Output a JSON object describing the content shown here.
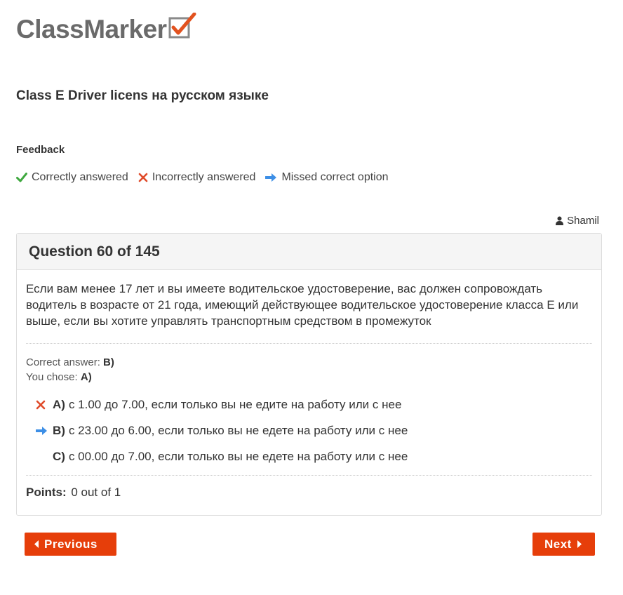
{
  "logo": {
    "text": "ClassMarker"
  },
  "test": {
    "title": "Class E Driver licens на русском языке"
  },
  "feedback": {
    "heading": "Feedback",
    "legend": {
      "correct": "Correctly answered",
      "incorrect": "Incorrectly answered",
      "missed": "Missed correct option"
    }
  },
  "user": {
    "name": "Shamil",
    "icon": "user-icon"
  },
  "question": {
    "header": "Question 60 of 145",
    "text": "Если вам менее 17 лет и вы имеете водительское удостоверение, вас должен сопровождать водитель в возрасте от 21 года, имеющий действующее водительское удостоверение класса Е или выше, если вы хотите управлять транспортным средством в промежуток",
    "correct_label": "Correct answer:",
    "correct_value": "B)",
    "chose_label": "You chose:",
    "chose_value": "A)",
    "options": [
      {
        "letter": "A)",
        "text": "с 1.00 до 7.00, если только вы не едите на работу или с нее",
        "mark": "incorrect"
      },
      {
        "letter": "B)",
        "text": "с 23.00 до 6.00, если только вы не едете на работу или с нее",
        "mark": "missed"
      },
      {
        "letter": "C)",
        "text": "с 00.00 до 7.00, если только вы не едете на работу или с нее",
        "mark": "none"
      }
    ],
    "points_label": "Points:",
    "points_value": "0 out of 1"
  },
  "nav": {
    "previous": "Previous",
    "next": "Next"
  },
  "colors": {
    "accent": "#e63e0a",
    "correct": "#3fa83f",
    "incorrect": "#e04b2a",
    "missed": "#3d8fe6",
    "logo_check": "#e2521f"
  }
}
